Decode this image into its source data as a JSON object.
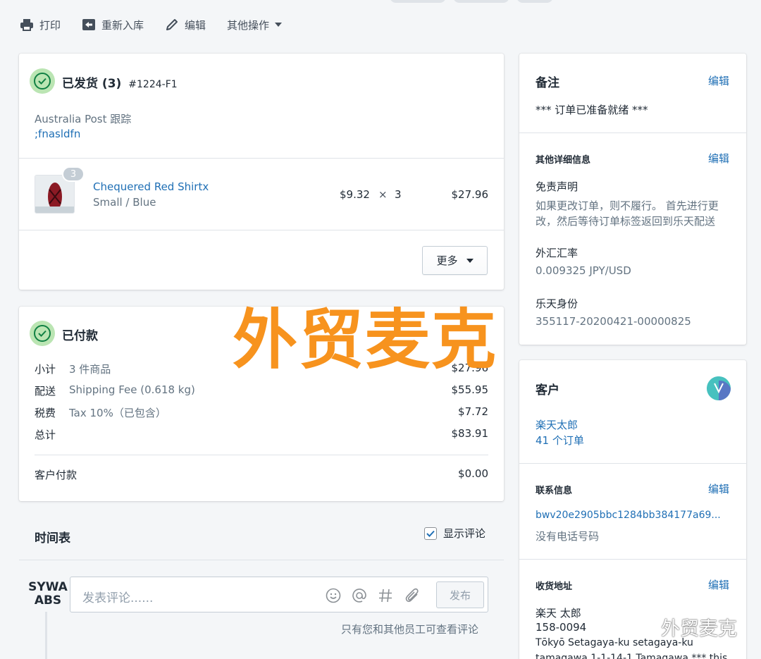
{
  "actions": {
    "print": "打印",
    "restock": "重新入库",
    "edit": "编辑",
    "more": "其他操作"
  },
  "fulfillment": {
    "title": "已发货 (3)",
    "order_no": "#1224-F1",
    "carrier_label": "Australia Post 跟踪",
    "tracking": ";fnasldfn",
    "item": {
      "qty_badge": "3",
      "name": "Chequered Red Shirtx",
      "variant": "Small / Blue",
      "unit_price": "$9.32",
      "times": "×",
      "qty": "3",
      "total": "$27.96"
    },
    "more_button": "更多"
  },
  "payment": {
    "title": "已付款",
    "rows": [
      {
        "label": "小计",
        "desc": "3 件商品",
        "amount": "$27.96"
      },
      {
        "label": "配送",
        "desc": "Shipping Fee (0.618 kg)",
        "amount": "$55.95"
      },
      {
        "label": "税费",
        "desc": "Tax 10%（已包含）",
        "amount": "$7.72"
      },
      {
        "label": "总计",
        "desc": "",
        "amount": "$83.91"
      }
    ],
    "paid_label": "客户付款",
    "paid_amount": "$0.00"
  },
  "timeline": {
    "title": "时间表",
    "show_comments": "显示评论",
    "avatar_text_line1": "SYWA",
    "avatar_text_line2": "ABS",
    "comment_placeholder": "发表评论......",
    "post_button": "发布",
    "hint": "只有您和其他员工可查看评论"
  },
  "notes": {
    "title": "备注",
    "edit": "编辑",
    "text": "*** 订单已准备就绪 ***"
  },
  "details": {
    "title": "其他详细信息",
    "edit": "编辑",
    "disclaimer_label": "免责声明",
    "disclaimer_line1": "如果更改订单，则不履行。 首先进行更",
    "disclaimer_line2": "改，然后等待订单标签返回到乐天配送",
    "fx_label": "外汇汇率",
    "fx_value": "0.009325 JPY/USD",
    "rakuten_label": "乐天身份",
    "rakuten_value": "355117-20200421-00000825"
  },
  "customer": {
    "title": "客户",
    "name": "楽天太郎",
    "orders": "41 个订单",
    "contact_title": "联系信息",
    "contact_edit": "编辑",
    "email": "bwv20e2905bbc1284bb384177a69...",
    "phone": "没有电话号码",
    "address_title": "收货地址",
    "address_edit": "编辑",
    "address_line1": "楽天 太郎",
    "address_line2": "158-0094",
    "address_line3": "Tōkyō Setagaya-ku setagaya-ku",
    "address_line4": "tamagawa 1-1-14-1 Tamagawa *** this"
  },
  "watermark": {
    "text": "外贸麦克",
    "wechat_text": "外贸麦克"
  },
  "colors": {
    "link": "#1f6fb5",
    "success": "#108043",
    "watermark": "#f7931e"
  }
}
